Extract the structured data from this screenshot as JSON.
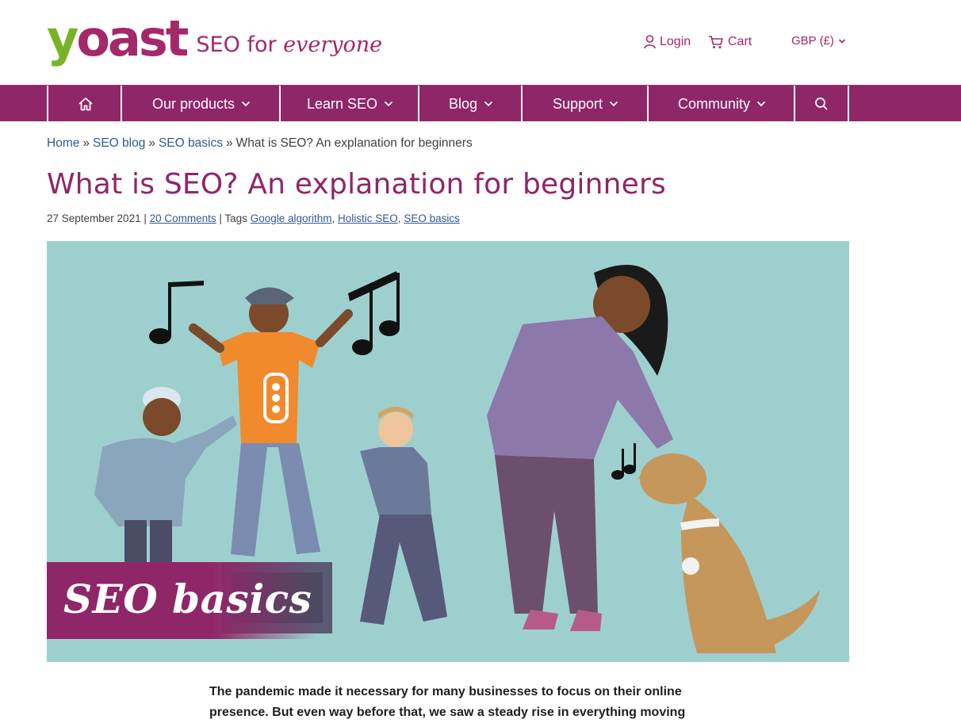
{
  "brand": {
    "logo_y": "y",
    "logo_rest": "oast",
    "tagline_prefix": "SEO for ",
    "tagline_emphasis": "everyone",
    "color_primary": "#a4286a",
    "color_green": "#77b227"
  },
  "header": {
    "login_label": "Login",
    "cart_label": "Cart",
    "currency_label": "GBP (£)"
  },
  "nav": {
    "items": [
      {
        "label": "Our products"
      },
      {
        "label": "Learn SEO"
      },
      {
        "label": "Blog"
      },
      {
        "label": "Support"
      },
      {
        "label": "Community"
      }
    ],
    "home_icon": "home-icon",
    "search_icon": "search-icon",
    "bg_color": "#8f2668"
  },
  "breadcrumb": {
    "items": [
      "Home",
      "SEO blog",
      "SEO basics"
    ],
    "separator": "»",
    "current": "What is SEO? An explanation for beginners"
  },
  "article": {
    "title": "What is SEO? An explanation for beginners",
    "date": "27 September 2021",
    "comments": "20 Comments",
    "tags_label": "Tags",
    "tags": [
      "Google algorithm",
      "Holistic SEO",
      "SEO basics"
    ],
    "hero_label": "SEO basics",
    "intro": "The pandemic made it necessary for many businesses to focus on their online presence. But even way before that, we saw a steady rise in everything moving"
  }
}
